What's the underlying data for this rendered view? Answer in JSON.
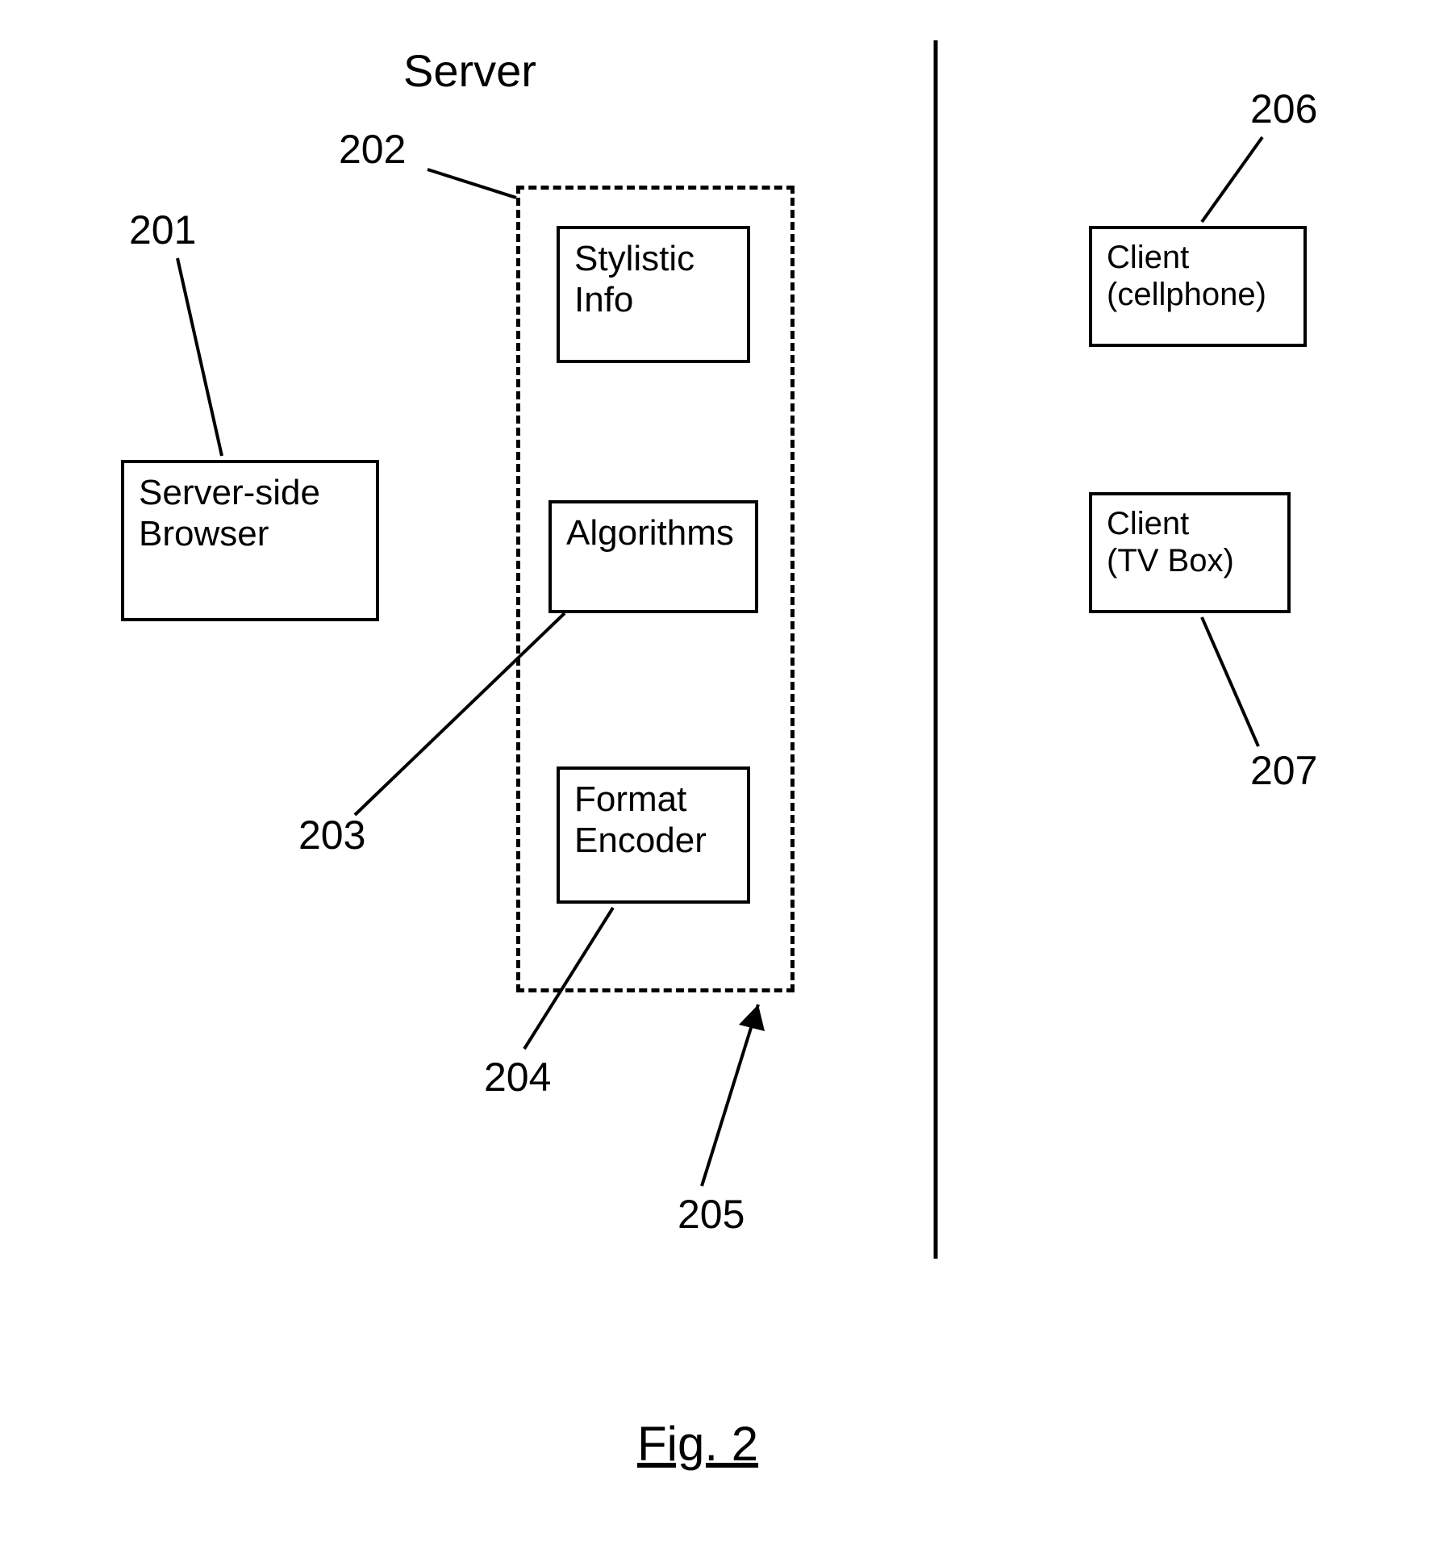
{
  "header": {
    "server_label": "Server"
  },
  "refs": {
    "r201": "201",
    "r202": "202",
    "r203": "203",
    "r204": "204",
    "r205": "205",
    "r206": "206",
    "r207": "207"
  },
  "boxes": {
    "server_side_browser": "Server-side\nBrowser",
    "stylistic_info": "Stylistic\nInfo",
    "algorithms": "Algorithms",
    "format_encoder": "Format\nEncoder",
    "client_cellphone": "Client\n(cellphone)",
    "client_tvbox": "Client\n(TV Box)"
  },
  "caption": "Fig. 2"
}
